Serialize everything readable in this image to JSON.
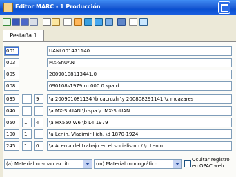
{
  "window": {
    "title": "Editor MARC - 1 Producción"
  },
  "toolbar": {
    "icons": [
      "new-icon",
      "save-icon",
      "save-as-icon",
      "copy-icon",
      "cut-icon",
      "paste-icon",
      "undo-icon",
      "insert-field-icon",
      "delete-field-icon",
      "move-up-icon",
      "move-down-icon",
      "print-icon",
      "search-icon",
      "help-icon"
    ]
  },
  "tabs": [
    {
      "label": "Pestaña 1"
    }
  ],
  "fields": [
    {
      "tag": "001",
      "ind1": "",
      "ind2": "",
      "value": "UANL001471140"
    },
    {
      "tag": "003",
      "ind1": "",
      "ind2": "",
      "value": "MX-SnUAN"
    },
    {
      "tag": "005",
      "ind1": "",
      "ind2": "",
      "value": "20090108113441.0"
    },
    {
      "tag": "008",
      "ind1": "",
      "ind2": "",
      "value": "090108s1979     ru           000 0 spa d"
    },
    {
      "tag": "035",
      "ind1": "",
      "ind2": "9",
      "value": "\\a 200901081134 \\b cacruzh \\y 200808291141 \\z mcazares"
    },
    {
      "tag": "040",
      "ind1": "",
      "ind2": "",
      "value": "\\a MX-SnUAN \\b spa \\c MX-SnUAN"
    },
    {
      "tag": "050",
      "ind1": "1",
      "ind2": "4",
      "value": "\\a HX550.W6 \\b L4 1979"
    },
    {
      "tag": "100",
      "ind1": "1",
      "ind2": "",
      "value": "\\a Lenin, Vladimir Ilich, \\d 1870-1924."
    },
    {
      "tag": "245",
      "ind1": "1",
      "ind2": "0",
      "value": "\\a Acerca del trabajo en el socialismo / \\c Lenin"
    }
  ],
  "bottom": {
    "material_type": "(a) Material no-manuscrito",
    "bibliographic_level": "(m) Material monográfico",
    "hide_opac_label": "Ocultar registro en OPAC web"
  }
}
